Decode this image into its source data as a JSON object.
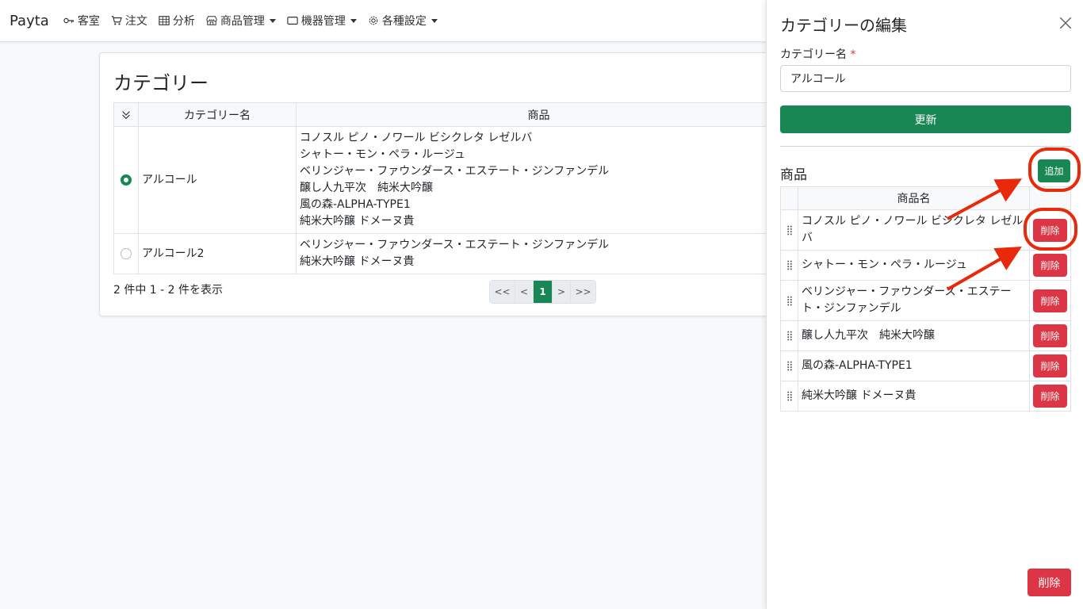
{
  "navbar": {
    "brand": "Payta",
    "items": [
      {
        "label": "客室",
        "icon": "key-icon",
        "dropdown": false
      },
      {
        "label": "注文",
        "icon": "cart-icon",
        "dropdown": false
      },
      {
        "label": "分析",
        "icon": "table-icon",
        "dropdown": false
      },
      {
        "label": "商品管理",
        "icon": "shop-icon",
        "dropdown": true
      },
      {
        "label": "機器管理",
        "icon": "tablet-icon",
        "dropdown": true
      },
      {
        "label": "各種設定",
        "icon": "gear-icon",
        "dropdown": true
      }
    ]
  },
  "main": {
    "title": "カテゴリー",
    "table": {
      "headers": [
        "カテゴリー名",
        "商品"
      ],
      "rows": [
        {
          "selected": true,
          "name": "アルコール",
          "products": [
            "コノスル ピノ・ノワール ビシクレタ レゼルバ",
            "シャトー・モン・ペラ・ルージュ",
            "ベリンジャー・ファウンダース・エステート・ジンファンデル",
            "醸し人九平次　純米大吟醸",
            "風の森-ALPHA-TYPE1",
            "純米大吟醸 ドメーヌ貴"
          ]
        },
        {
          "selected": false,
          "name": "アルコール2",
          "products": [
            "ベリンジャー・ファウンダース・エステート・ジンファンデル",
            "純米大吟醸 ドメーヌ貴"
          ]
        }
      ]
    },
    "count_text": "2 件中 1 - 2 件を表示",
    "pager": [
      "<<",
      "<",
      "1",
      ">",
      ">>"
    ]
  },
  "panel": {
    "title": "カテゴリーの編集",
    "name_label": "カテゴリー名",
    "required_mark": "*",
    "name_value": "アルコール",
    "update_label": "更新",
    "section_title": "商品",
    "add_label": "追加",
    "products_header": "商品名",
    "products": [
      "コノスル ピノ・ノワール ビシクレタ レゼルバ",
      "シャトー・モン・ペラ・ルージュ",
      "ベリンジャー・ファウンダース・エステート・ジンファンデル",
      "醸し人九平次　純米大吟醸",
      "風の森-ALPHA-TYPE1",
      "純米大吟醸 ドメーヌ貴"
    ],
    "delete_label": "削除",
    "delete_category_label": "削除"
  },
  "colors": {
    "primary": "#198754",
    "danger": "#dc3545",
    "annotation": "#e8290b"
  }
}
